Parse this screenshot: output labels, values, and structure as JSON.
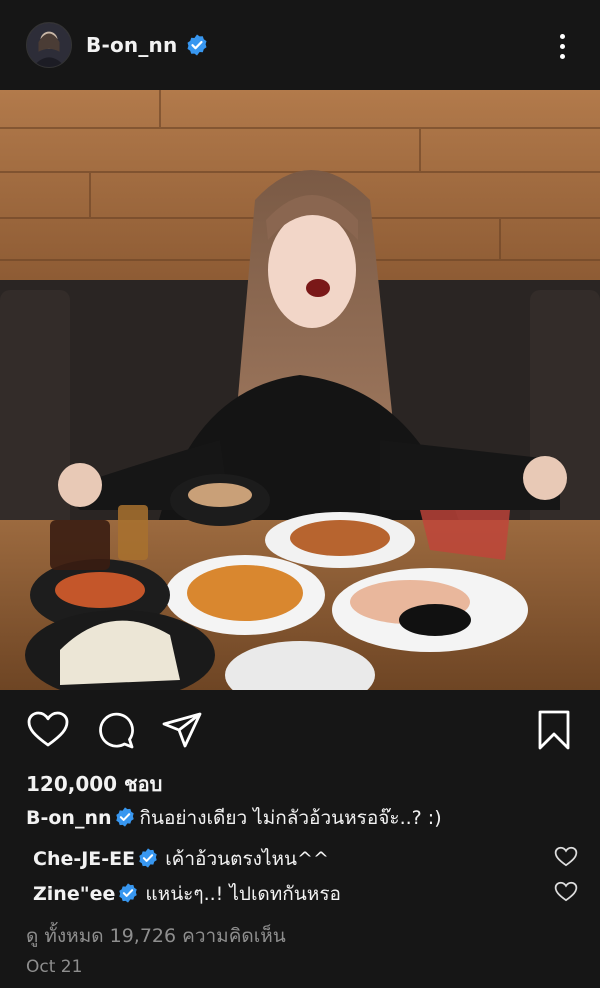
{
  "post": {
    "username": "B-on_nn",
    "likes_text": "120,000 ชอบ",
    "caption_user": "B-on_nn",
    "caption_text": "กินอย่างเดียว ไม่กลัวอ้วนหรอจ๊ะ..? :)",
    "comments": [
      {
        "user": "Che-JE-EE",
        "text": "เค้าอ้วนตรงไหน^^"
      },
      {
        "user": "Zine\"ee",
        "text": "แหน่ะๆ..! ไปเดทกันหรอ"
      }
    ],
    "view_all_text": "ดู ทั้งหมด 19,726 ความคิดเห็น",
    "date_text": "Oct 21"
  },
  "icons": {
    "verified": "verified-badge-icon",
    "more": "more-options-icon",
    "like": "heart-icon",
    "comment": "comment-icon",
    "share": "send-icon",
    "save": "bookmark-icon"
  },
  "colors": {
    "background": "#161616",
    "verified_blue": "#3897f0",
    "muted_text": "#8e8e8e"
  }
}
